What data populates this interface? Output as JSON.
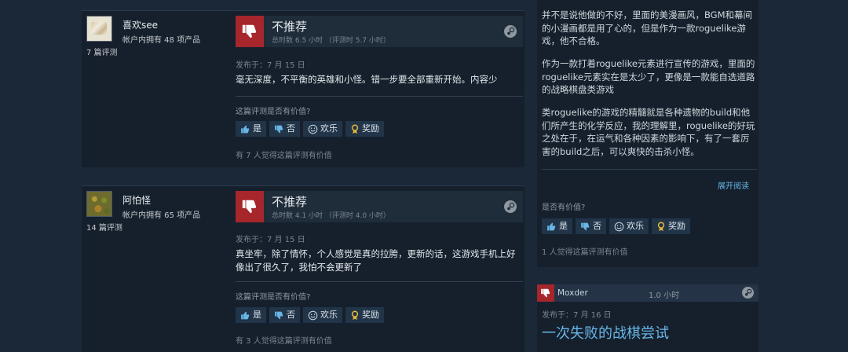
{
  "reviews": [
    {
      "author": {
        "name": "喜欢see",
        "products": "帐户内拥有 48 项产品",
        "review_count": "7 篇评测"
      },
      "verdict": "不推荐",
      "hours": "总时数 6.5 小时 （评测时 5.7 小时）",
      "posted": "发布于：7 月 15 日",
      "content": "毫无深度，不平衡的英雄和小怪。错一步要全部重新开始。内容少",
      "question": "这篇评测是否有价值?",
      "buttons": {
        "yes": "是",
        "no": "否",
        "funny": "欢乐",
        "award": "奖励"
      },
      "helpful": "有 7 人觉得这篇评测有价值"
    },
    {
      "author": {
        "name": "阿怕怪",
        "products": "帐户内拥有 65 项产品",
        "review_count": "14 篇评测"
      },
      "verdict": "不推荐",
      "hours": "总时数 4.1 小时 （评测时 4.0 小时）",
      "posted": "发布于：7 月 15 日",
      "content": "真坐牢，除了情怀，个人感觉是真的拉胯，更新的话，这游戏手机上好像出了很久了，我怕不会更新了",
      "question": "这篇评测是否有价值?",
      "buttons": {
        "yes": "是",
        "no": "否",
        "funny": "欢乐",
        "award": "奖励"
      },
      "helpful": "有 3 人觉得这篇评测有价值"
    }
  ],
  "side_review": {
    "paragraphs": [
      "并不是说他做的不好，里面的美漫画风，BGM和幕间的小漫画都是用了心的，但是作为一款roguelike游戏，他不合格。",
      "作为一款打着roguelike元素进行宣传的游戏，里面的roguelike元素实在是太少了，更像是一款能自选道路的战略棋盘类游戏",
      "类roguelike的游戏的精髓就是各种遗物的build和他们所产生的化学反应，我的理解里，roguelike的好玩之处在于，在运气和各种因素的影响下，有了一套厉害的build之后，可以爽快的击杀小怪。"
    ],
    "expand": "展开阅读",
    "question": "是否有价值?",
    "buttons": {
      "yes": "是",
      "no": "否",
      "funny": "欢乐",
      "award": "奖励"
    },
    "helpful": "1 人觉得这篇评测有价值"
  },
  "mini_review": {
    "name": "Moxder",
    "hours": "1.0 小时",
    "posted": "发布于：7 月 16 日",
    "title": "一次失败的战棋尝试"
  }
}
